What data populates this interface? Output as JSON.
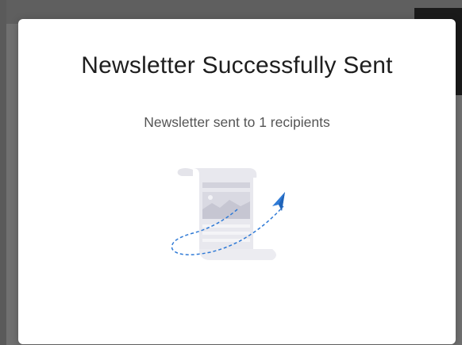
{
  "modal": {
    "title": "Newsletter Successfully Sent",
    "message": "Newsletter sent to 1 recipients",
    "illustration_icon": "newsletter-sent-illustration"
  },
  "colors": {
    "overlay": "#707070",
    "modal_background": "#ffffff",
    "title_text": "#1e1e1e",
    "message_text": "#555555",
    "accent_blue": "#2f7ad6",
    "paper_grey": "#e6e6ec"
  }
}
